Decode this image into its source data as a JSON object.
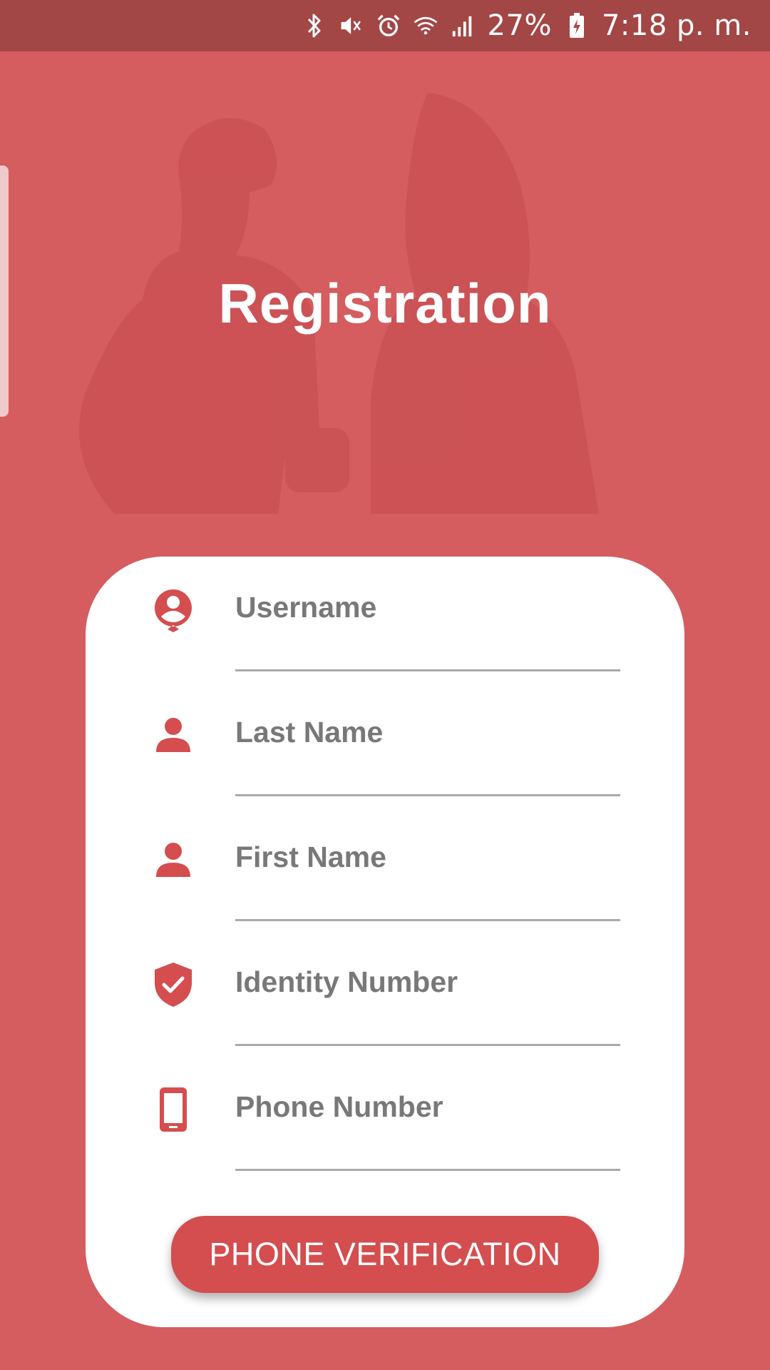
{
  "status_bar": {
    "battery": "27%",
    "time": "7:18 p. m.",
    "icons": [
      "bluetooth-icon",
      "mute-icon",
      "alarm-icon",
      "wifi-icon",
      "signal-icon",
      "battery-icon"
    ]
  },
  "header": {
    "title": "Registration"
  },
  "form": {
    "fields": [
      {
        "label": "Username",
        "icon": "account-circle-icon"
      },
      {
        "label": "Last Name",
        "icon": "person-icon"
      },
      {
        "label": "First Name",
        "icon": "person-icon"
      },
      {
        "label": "Identity Number",
        "icon": "shield-check-icon"
      },
      {
        "label": "Phone Number",
        "icon": "phone-icon"
      }
    ],
    "submit_label": "PHONE VERIFICATION"
  },
  "colors": {
    "background": "#d55d5f",
    "status_bar": "#a34646",
    "accent": "#d44d4f",
    "field_text": "#787878"
  }
}
